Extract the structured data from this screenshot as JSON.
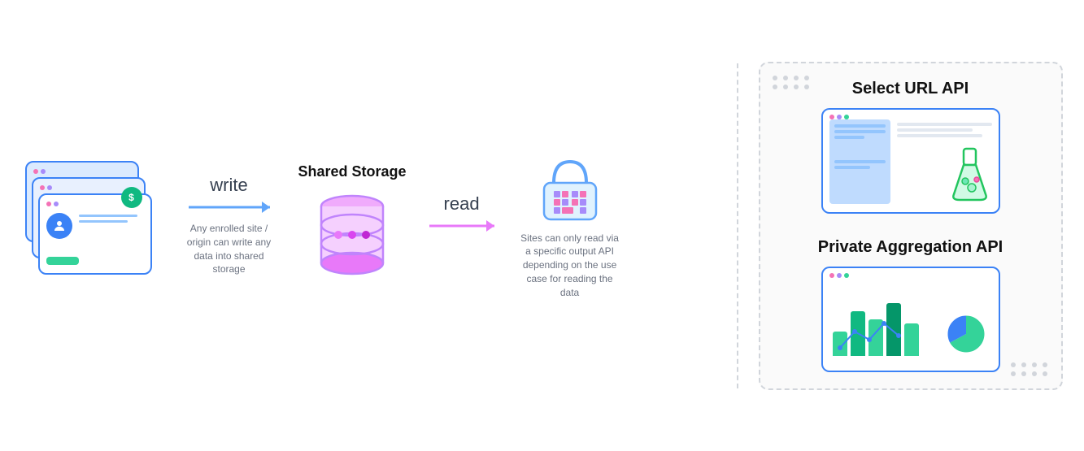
{
  "diagram": {
    "write_label": "write",
    "read_label": "read",
    "shared_storage_title": "Shared Storage",
    "write_desc": "Any enrolled site / origin can write any data into shared storage",
    "read_desc": "Sites can only read via a specific output API depending on the use case for reading the data"
  },
  "right_panel": {
    "api1_title": "Select URL API",
    "api2_title": "Private Aggregation API"
  }
}
